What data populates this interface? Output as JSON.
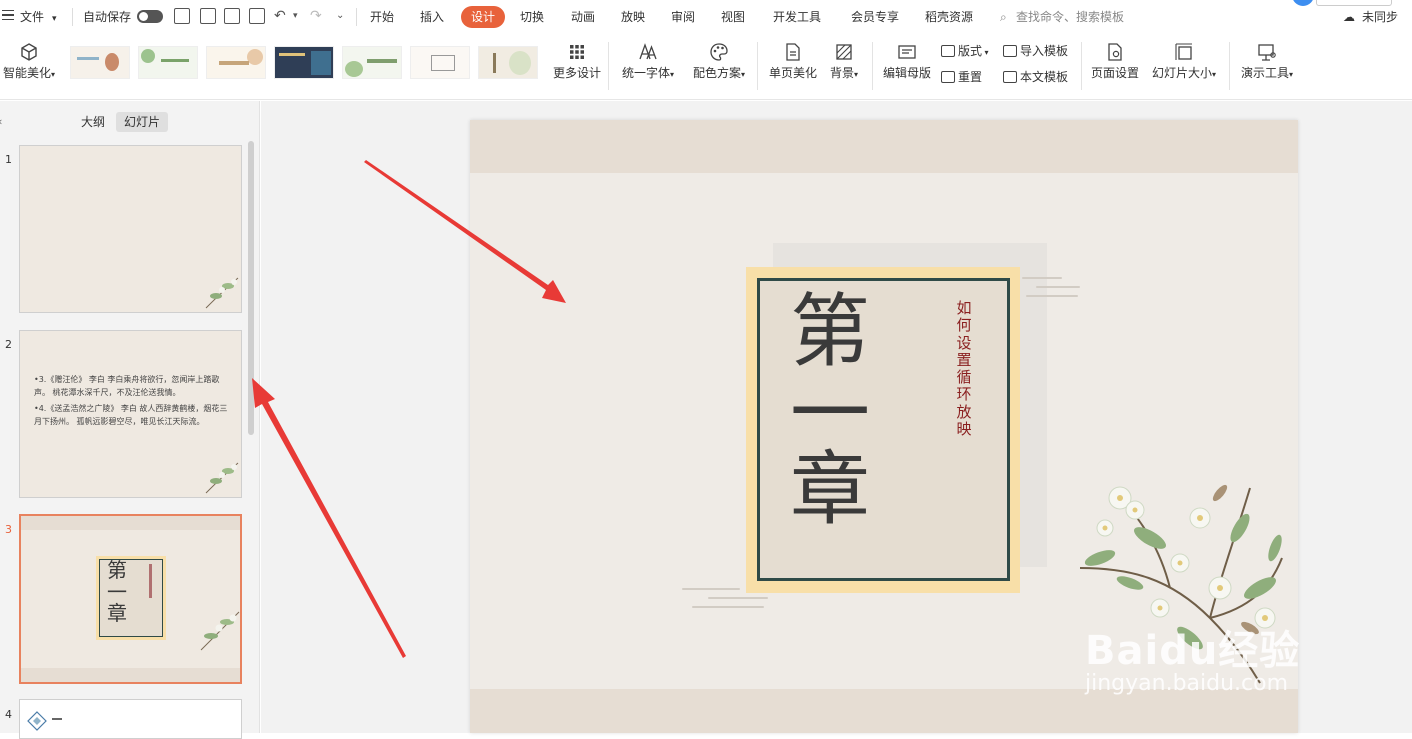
{
  "menubar": {
    "file": "文件",
    "autosave": "自动保存",
    "tabs": [
      "开始",
      "插入",
      "设计",
      "切换",
      "动画",
      "放映",
      "审阅",
      "视图",
      "开发工具",
      "会员专享",
      "稻壳资源"
    ],
    "active_tab": "设计",
    "search_placeholder": "查找命令、搜索模板",
    "sync": "未同步"
  },
  "ribbon": {
    "smart_beautify": "智能美化",
    "more_design": "更多设计",
    "unify_font": "统一字体",
    "color_scheme": "配色方案",
    "single_page_beautify": "单页美化",
    "background": "背景",
    "edit_master": "编辑母版",
    "layout": "版式",
    "reset": "重置",
    "import_template": "导入模板",
    "this_template": "本文模板",
    "page_setup": "页面设置",
    "slide_size": "幻灯片大小",
    "present_tools": "演示工具"
  },
  "left_panel": {
    "tabs": [
      "大纲",
      "幻灯片"
    ],
    "active_tab": "幻灯片",
    "slides": [
      {
        "number": "1"
      },
      {
        "number": "2",
        "lines": [
          "•3.《赠汪伦》 李白 李白乘舟将欲行，忽闻岸上踏歌声。 桃花潭水深千尺，不及汪伦送我情。",
          "•4.《送孟浩然之广陵》 李白 故人西辞黄鹤楼，烟花三月下扬州。 孤帆远影碧空尽，唯见长江天际流。"
        ]
      },
      {
        "number": "3",
        "chars": [
          "第",
          "一",
          "章"
        ]
      },
      {
        "number": "4"
      }
    ],
    "current_slide": "3"
  },
  "slide": {
    "chars": [
      "第",
      "一",
      "章"
    ],
    "vertical_text": "如何设置循环放映"
  },
  "watermark": {
    "brand": "Baidu经验",
    "url": "jingyan.baidu.com"
  },
  "colors": {
    "accent": "#e8623b",
    "frame_border": "#2f4a47",
    "frame_gold": "#f8dfa8",
    "vertical_text": "#8a1f1f",
    "arrow": "#e83a36"
  }
}
